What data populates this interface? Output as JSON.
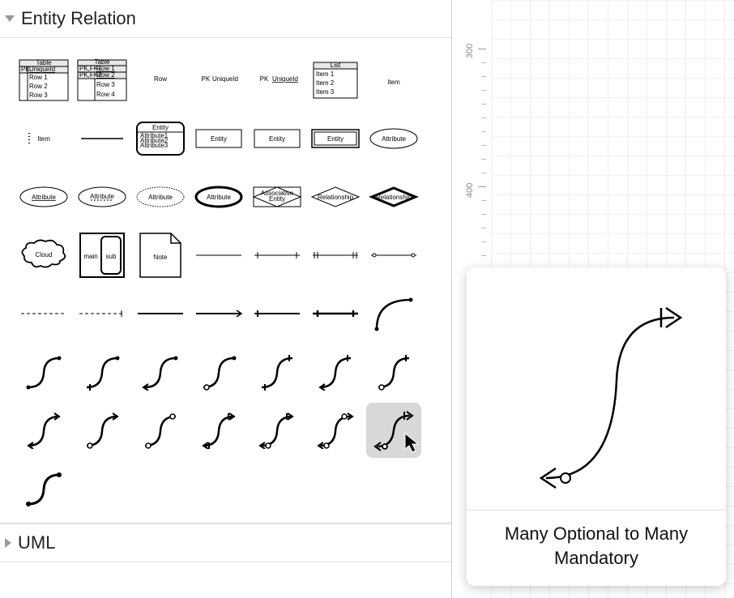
{
  "sections": {
    "entity_relation": {
      "title": "Entity Relation",
      "expanded": true
    },
    "uml": {
      "title": "UML",
      "expanded": false
    }
  },
  "ruler_marks": [
    "300",
    "400"
  ],
  "tooltip": {
    "label": "Many Optional to Many Mandatory"
  },
  "shapes": {
    "table1": {
      "header": "Table",
      "col0": "PK",
      "col1": "UniqueId",
      "rows": [
        "Row 1",
        "Row 2",
        "Row 3"
      ]
    },
    "table2": {
      "header": "Table",
      "rows": [
        [
          "PK,FK1",
          "Row 1"
        ],
        [
          "PK,FK2",
          "Row 2"
        ],
        [
          "",
          "Row 3"
        ],
        [
          "",
          "Row 4"
        ]
      ]
    },
    "row": "Row",
    "pk_uid": {
      "pk": "PK",
      "uid": "UniqueId"
    },
    "pk_uid_u": {
      "pk": "PK",
      "uid": "UniqueId"
    },
    "list": {
      "header": "List",
      "items": [
        "Item 1",
        "Item 2",
        "Item 3"
      ]
    },
    "item": "Item",
    "item_dots": "Item",
    "entity_rounded": {
      "title": "Entity",
      "attrs": [
        "Attribute1",
        "Attribute2",
        "Attribute3"
      ]
    },
    "entity_rect": "Entity",
    "entity_rect2": "Entity",
    "entity_dbl": "Entity",
    "attribute_oval": "Attribute",
    "attribute_oval_u": "Attribute",
    "attribute_dashed": "Attribute",
    "attribute_dotted": "Attribute",
    "attribute_bold": "Attribute",
    "assoc_entity": "Associative\nEntity",
    "relationship": "Relationship",
    "relationship_bold": "Relationship",
    "cloud": "Cloud",
    "main_sub": {
      "main": "main",
      "sub": "sub"
    },
    "note": "Note"
  }
}
